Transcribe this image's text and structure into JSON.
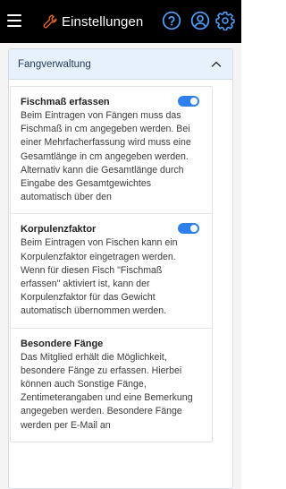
{
  "header": {
    "title": "Einstellungen",
    "menu_icon": "hamburger-menu-icon",
    "title_icon": "wrench-icon",
    "actions": [
      {
        "icon": "help-icon"
      },
      {
        "icon": "user-icon"
      },
      {
        "icon": "gear-icon"
      }
    ],
    "colors": {
      "background": "#000000",
      "accent": "#e86a2b",
      "icon": "#4da3ff"
    }
  },
  "panel": {
    "title": "Fangverwaltung",
    "expanded": true,
    "settings": [
      {
        "title": "Fischmaß erfassen",
        "enabled": true,
        "description": "Beim Eintragen von Fängen muss das Fischmaß in cm angegeben werden. Bei einer Mehrfacherfassung wird muss eine Gesamtlänge in cm angegeben werden. Alternativ kann die Gesamtlänge durch Eingabe des Gesamtgewichtes automatisch über den"
      },
      {
        "title": "Korpulenzfaktor",
        "enabled": true,
        "description": "Beim Eintragen von Fischen kann ein Korpulenzfaktor eingetragen werden. Wenn für diesen Fisch \"Fischmaß erfassen\" aktiviert ist, kann der Korpulenzfaktor für das Gewicht automatisch übernommen werden."
      },
      {
        "title": "Besondere Fänge",
        "description": "Das Mitglied erhält die Möglichkeit, besondere Fänge zu erfassen. Hierbei können auch Sonstige Fänge, Zentimeterangaben und eine Bemerkung angegeben werden. Besondere Fänge werden per E-Mail an"
      }
    ],
    "colors": {
      "header_bg": "#e7f1fb",
      "toggle_on": "#2f80ed"
    }
  }
}
